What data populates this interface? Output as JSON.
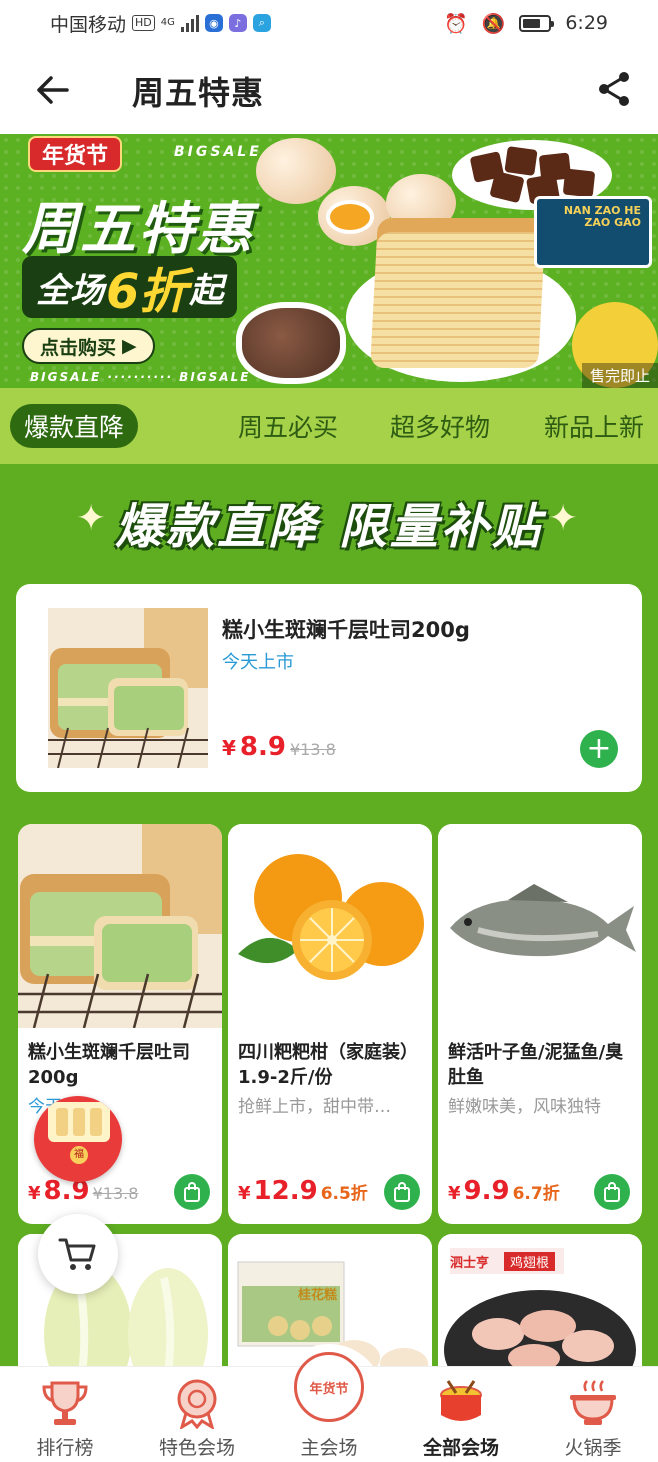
{
  "status": {
    "carrier": "中国移动",
    "hd": "HD",
    "network": "4G",
    "time": "6:29"
  },
  "header": {
    "title": "周五特惠"
  },
  "banner": {
    "festival": "年货节",
    "bigsale_top": "BIGSALE",
    "title": "周五特惠",
    "sub_prefix": "全场",
    "sub_highlight": "6折",
    "sub_suffix": "起",
    "buy_label": "点击购买",
    "bigsale_bottom": "BIGSALE ·········· BIGSALE",
    "sold_out_label": "售完即止",
    "box_text": "NAN ZAO HE ZAO GAO"
  },
  "tabs": [
    {
      "label": "爆款直降",
      "active": true
    },
    {
      "label": "周五必买",
      "active": false
    },
    {
      "label": "超多好物",
      "active": false
    },
    {
      "label": "新品上新",
      "active": false
    }
  ],
  "section": {
    "title": "爆款直降 限量补贴"
  },
  "featured": {
    "name": "糕小生斑斓千层吐司200g",
    "tag": "今天上市",
    "price_symbol": "¥",
    "price": "8.9",
    "original_price": "¥13.8"
  },
  "products": [
    {
      "name": "糕小生斑斓千层吐司200g",
      "desc": "今天上市",
      "price_symbol": "¥",
      "price": "8.9",
      "original_price": "¥13.8",
      "discount": ""
    },
    {
      "name": "四川粑粑柑（家庭装）1.9-2斤/份",
      "desc": "抢鲜上市，甜中带…",
      "price_symbol": "¥",
      "price": "12.9",
      "original_price": "",
      "discount": "6.5折"
    },
    {
      "name": "鲜活叶子鱼/泥猛鱼/臭肚鱼",
      "desc": "鲜嫩味美，风味独特",
      "price_symbol": "¥",
      "price": "9.9",
      "original_price": "",
      "discount": "6.7折"
    }
  ],
  "row2": {
    "box_label": "桂花糕",
    "chicken_brand": "泗士亨",
    "chicken_label": "鸡翅根"
  },
  "redpack": {
    "seal": "福"
  },
  "nav": [
    {
      "label": "排行榜",
      "icon": "trophy-icon"
    },
    {
      "label": "特色会场",
      "icon": "medal-icon"
    },
    {
      "label": "主会场",
      "icon": "festival-logo-icon"
    },
    {
      "label": "全部会场",
      "icon": "drum-icon"
    },
    {
      "label": "火锅季",
      "icon": "hotpot-icon"
    }
  ],
  "nav_center_text": "年货节",
  "colors": {
    "brand_green": "#5fae22",
    "price_red": "#e8202a",
    "cart_green": "#2fb24e",
    "link_blue": "#2a9ad6"
  }
}
